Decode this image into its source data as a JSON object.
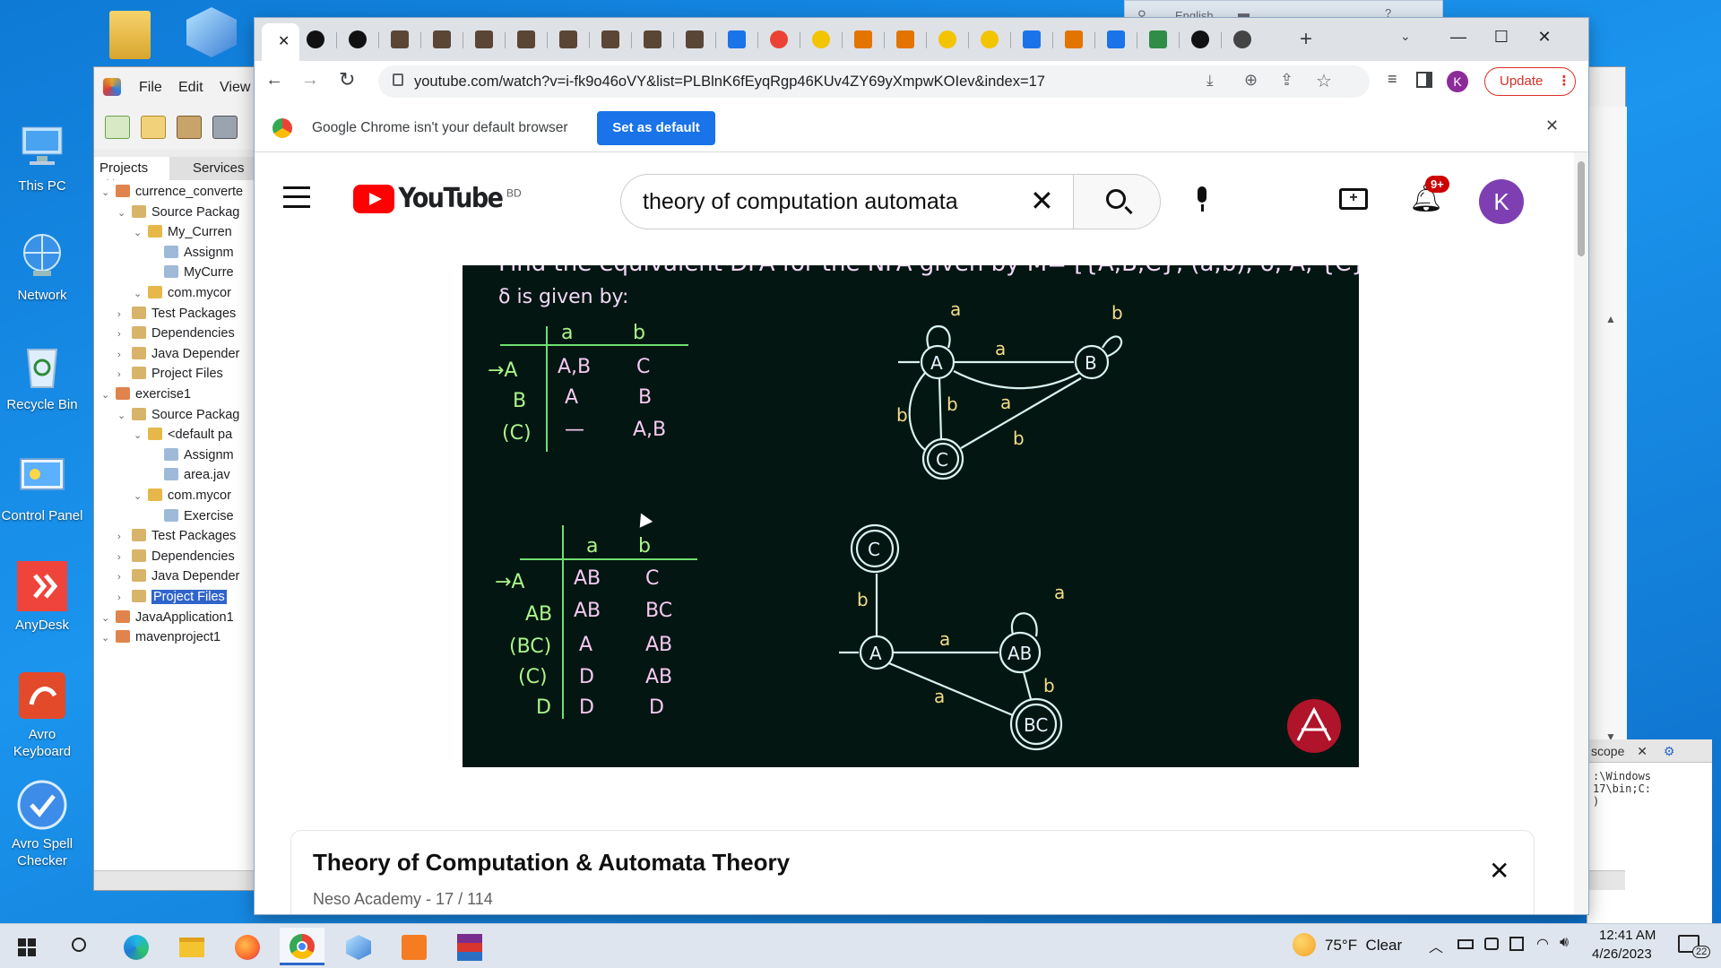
{
  "desktop": {
    "icons": [
      {
        "label": "This PC"
      },
      {
        "label": "Network"
      },
      {
        "label": "Recycle Bin"
      },
      {
        "label": "Control Panel"
      },
      {
        "label": "AnyDesk"
      },
      {
        "label": "Avro Keyboard"
      },
      {
        "label": "Avro Spell Checker"
      }
    ]
  },
  "netbeans": {
    "menu": [
      "File",
      "Edit",
      "View"
    ],
    "tabs": {
      "projects": "Projects",
      "services": "Services"
    },
    "tree": [
      "currence_converte",
      "Source Packag",
      "My_Curren",
      "Assignm",
      "MyCurre",
      "com.mycor",
      "Test Packages",
      "Dependencies",
      "Java Depender",
      "Project Files",
      "exercise1",
      "Source Packag",
      "<default pa",
      "Assignm",
      "area.jav",
      "com.mycor",
      "Exercise",
      "Test Packages",
      "Dependencies",
      "Java Depender",
      "Project Files",
      "JavaApplication1",
      "mavenproject1"
    ],
    "output_tab": "scope",
    "output_lines": [
      ":\\Windows",
      "17\\bin;C:",
      ")"
    ]
  },
  "language_bar": {
    "text": "English"
  },
  "chrome": {
    "url": "youtube.com/watch?v=i-fk9o46oVY&list=PLBlnK6fEyqRgp46KUv4ZY69yXmpwKOIev&index=17",
    "update_label": "Update",
    "profile_initial": "K",
    "infobar_text": "Google Chrome isn't your default browser",
    "set_default_label": "Set as default"
  },
  "youtube": {
    "logo_text": "YouTube",
    "country": "BD",
    "search_value": "theory of computation automata",
    "notification_count": "9+",
    "avatar_initial": "K",
    "video_text": {
      "heading": "Find the equivalent DFA for the NFA given by M= [{A,B,C}, (a,b), δ, A, {C}] where",
      "delta": "δ is given by:",
      "nfa_table": {
        "header": [
          "a",
          "b"
        ],
        "rows": [
          {
            "state": "→A",
            "a": "A,B",
            "b": "C"
          },
          {
            "state": "B",
            "a": "A",
            "b": "B"
          },
          {
            "state": "(C)",
            "a": "—",
            "b": "A,B"
          }
        ]
      },
      "dfa_table": {
        "header": [
          "a",
          "b"
        ],
        "rows": [
          {
            "state": "→A",
            "a": "AB",
            "b": "C"
          },
          {
            "state": "AB",
            "a": "AB",
            "b": "BC"
          },
          {
            "state": "(BC)",
            "a": "A",
            "b": "AB"
          },
          {
            "state": "(C)",
            "a": "D",
            "b": "AB"
          },
          {
            "state": "D",
            "a": "D",
            "b": "D"
          }
        ]
      },
      "nfa_graph": {
        "states": [
          "A",
          "B",
          "C"
        ],
        "labels": [
          "a",
          "b",
          "a",
          "b",
          "a",
          "b",
          "b"
        ]
      },
      "dfa_graph": {
        "states": [
          "C",
          "A",
          "AB",
          "BC"
        ],
        "labels": [
          "b",
          "a",
          "a",
          "b",
          "a"
        ]
      }
    },
    "playlist": {
      "title": "Theory of Computation & Automata Theory",
      "subtitle": "Neso Academy - 17 / 114"
    }
  },
  "taskbar": {
    "weather": "75°F  Clear",
    "time": "12:41 AM",
    "date": "4/26/2023",
    "notifications": "22"
  }
}
